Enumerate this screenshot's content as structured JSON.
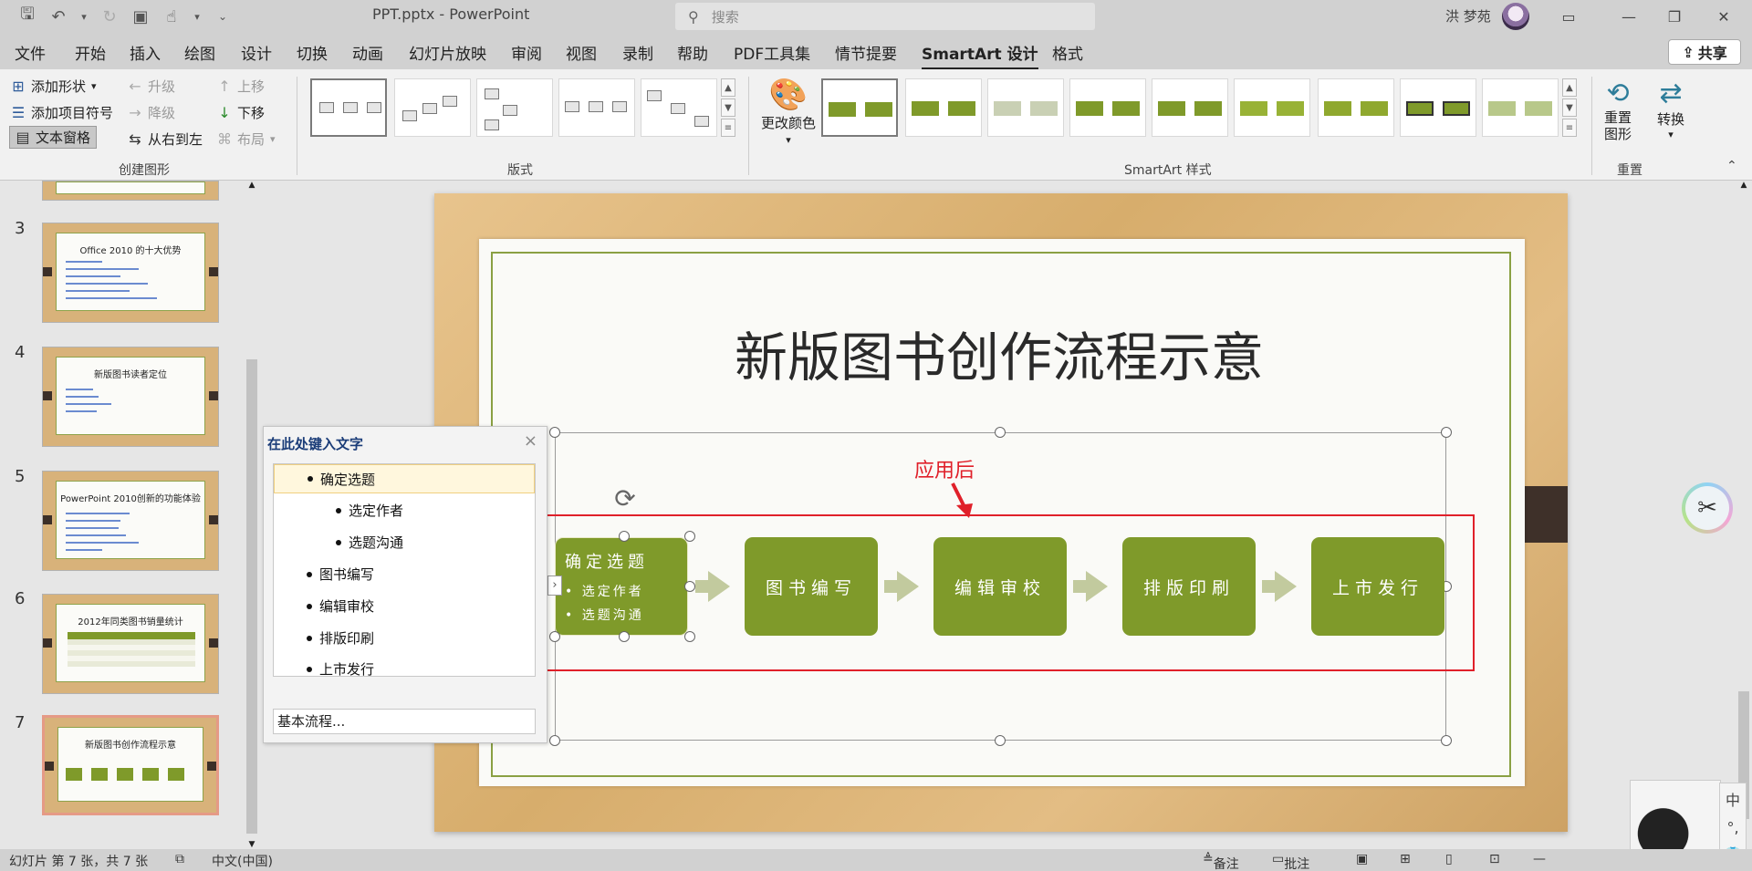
{
  "window": {
    "doc_title": "PPT.pptx  -  PowerPoint",
    "search_placeholder": "搜索",
    "user_name": "洪 梦苑"
  },
  "menu": {
    "tabs": [
      "文件",
      "开始",
      "插入",
      "绘图",
      "设计",
      "切换",
      "动画",
      "幻灯片放映",
      "审阅",
      "视图",
      "录制",
      "帮助",
      "PDF工具集",
      "情节提要",
      "SmartArt 设计",
      "格式"
    ],
    "active_tab": "SmartArt 设计",
    "share_label": "共享"
  },
  "ribbon": {
    "create": {
      "add_shape": "添加形状",
      "add_bullet": "添加项目符号",
      "text_pane": "文本窗格",
      "promote": "升级",
      "demote": "降级",
      "rtl": "从右到左",
      "move_up": "上移",
      "move_down": "下移",
      "layout": "布局",
      "group_label": "创建图形"
    },
    "layouts_label": "版式",
    "change_colors": "更改颜色",
    "styles_label": "SmartArt 样式",
    "reset_graphic": "重置\n图形",
    "convert": "转换",
    "reset_label": "重置"
  },
  "slides": [
    {
      "num": "3",
      "title": "Office 2010 的十大优势"
    },
    {
      "num": "4",
      "title": "新版图书读者定位"
    },
    {
      "num": "5",
      "title": "PowerPoint 2010创新的功能体验"
    },
    {
      "num": "6",
      "title": "2012年同类图书销量统计"
    },
    {
      "num": "7",
      "title": "新版图书创作流程示意"
    }
  ],
  "text_pane": {
    "title": "在此处键入文字",
    "items": [
      {
        "text": "确定选题",
        "level": 1
      },
      {
        "text": "选定作者",
        "level": 2
      },
      {
        "text": "选题沟通",
        "level": 2
      },
      {
        "text": "图书编写",
        "level": 1
      },
      {
        "text": "编辑审校",
        "level": 1
      },
      {
        "text": "排版印刷",
        "level": 1
      },
      {
        "text": "上市发行",
        "level": 1
      }
    ],
    "footer": "基本流程..."
  },
  "slide": {
    "title": "新版图书创作流程示意",
    "annotation": "应用后",
    "steps": [
      "确定选题",
      "图书编写",
      "编辑审校",
      "排版印刷",
      "上市发行"
    ],
    "first_sub": [
      "选定作者",
      "选题沟通"
    ]
  },
  "colors": {
    "accent_green": "#7f9a2a",
    "annotation_red": "#e0202a"
  },
  "ime": {
    "mode": "中",
    "punct": "°,"
  },
  "status": {
    "slide_info": "幻灯片 第 7 张，共 7 张",
    "language": "中文(中国)",
    "notes": "备注",
    "comments": "批注"
  }
}
